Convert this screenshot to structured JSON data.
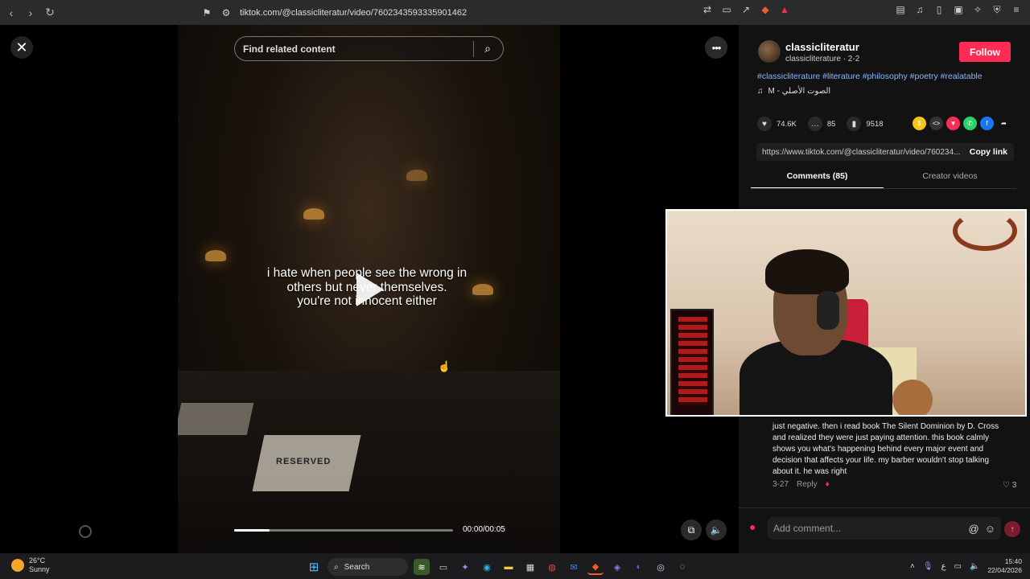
{
  "browser": {
    "url": "tiktok.com/@classicliteratur/video/7602343593335901462"
  },
  "video": {
    "search_placeholder": "Find related content",
    "caption_line1": "i hate when people see the wrong in",
    "caption_line2": "others but never themselves.",
    "caption_line3": "you're not innocent either",
    "reserved_sign": "RESERVED",
    "time": "00:00/00:05",
    "progress": 0.16
  },
  "creator": {
    "username": "classicliteratur",
    "subname": "classicliterature · 2-2",
    "follow_label": "Follow",
    "hashtags": "#classicliterature #literature #philosophy #poetry #realatable",
    "sound": "M - الصوت الأصلي"
  },
  "stats": {
    "likes": "74.6K",
    "comments": "85",
    "saves": "9518"
  },
  "link": {
    "url": "https://www.tiktok.com/@classicliteratur/video/760234...",
    "copy_label": "Copy link"
  },
  "tabs": {
    "comments": "Comments (85)",
    "creator_videos": "Creator videos"
  },
  "comment": {
    "text": "just negative. then i read book The Silent Dominion by D. Cross and realized they were just paying attention. this book calmly shows you what's happening behind every major event and decision that affects your life. my barber wouldn't stop talking about it. he was right",
    "date": "3-27",
    "reply_label": "Reply",
    "likes": "3"
  },
  "add_comment": {
    "placeholder": "Add comment..."
  },
  "taskbar": {
    "temp": "26°C",
    "condition": "Sunny",
    "search_label": "Search",
    "lang": "ع",
    "time": "15:40",
    "date": "22/04/2026"
  },
  "colors": {
    "follow": "#fe2c55",
    "hashtag": "#8cb6ff",
    "panel_bg": "#121212"
  }
}
